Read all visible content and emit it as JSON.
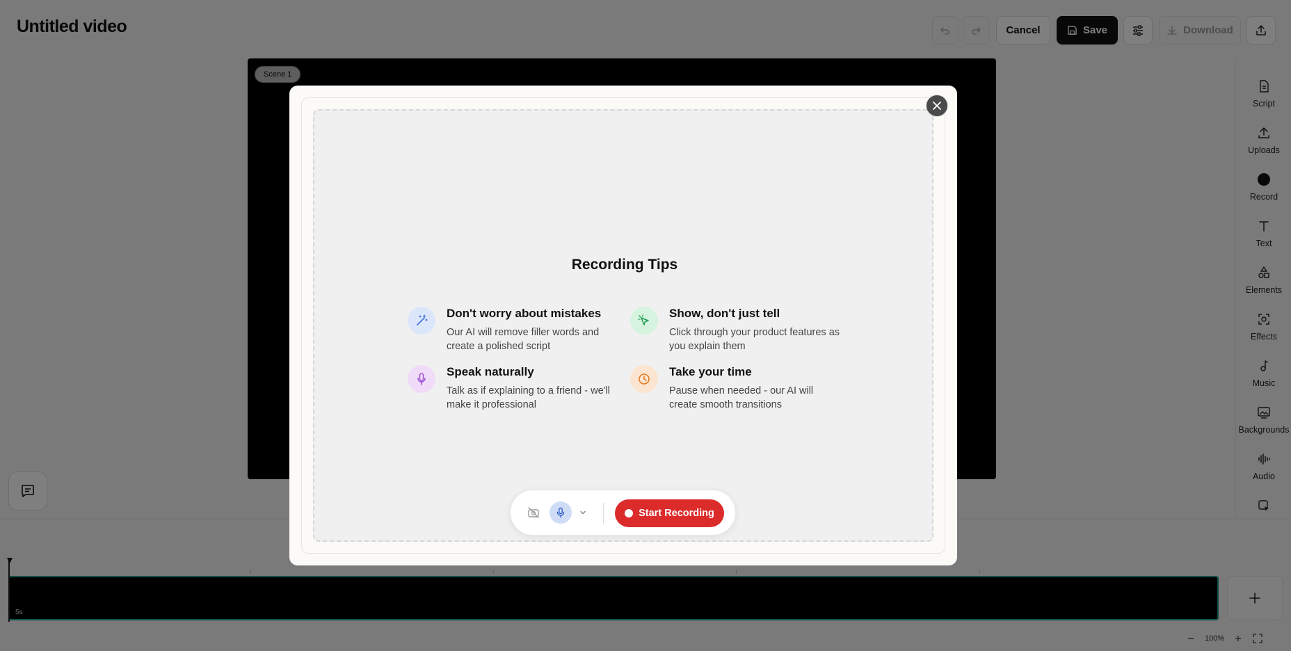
{
  "header": {
    "title": "Untitled video",
    "cancel_label": "Cancel",
    "save_label": "Save",
    "download_label": "Download"
  },
  "canvas": {
    "scene_label": "Scene 1"
  },
  "sidebar": {
    "items": [
      {
        "label": "Script",
        "icon": "document-icon"
      },
      {
        "label": "Uploads",
        "icon": "upload-icon"
      },
      {
        "label": "Record",
        "icon": "record-icon"
      },
      {
        "label": "Text",
        "icon": "text-icon"
      },
      {
        "label": "Elements",
        "icon": "shapes-icon"
      },
      {
        "label": "Effects",
        "icon": "effects-icon"
      },
      {
        "label": "Music",
        "icon": "music-note-icon"
      },
      {
        "label": "Backgrounds",
        "icon": "image-icon"
      },
      {
        "label": "Audio",
        "icon": "waveform-icon"
      }
    ]
  },
  "timeline": {
    "clip_duration": "5s",
    "zoom_level": "100%"
  },
  "modal": {
    "title": "Recording Tips",
    "tips": [
      {
        "heading": "Don't worry about mistakes",
        "description": "Our AI will remove filler words and create a polished script",
        "icon": "magic-wand-icon",
        "color": "#3b6fd8"
      },
      {
        "heading": "Show, don't just tell",
        "description": "Click through your product features as you explain them",
        "icon": "cursor-click-icon",
        "color": "#1f9d55"
      },
      {
        "heading": "Speak naturally",
        "description": "Talk as if explaining to a friend - we'll make it professional",
        "icon": "microphone-icon",
        "color": "#9b4fd1"
      },
      {
        "heading": "Take your time",
        "description": "Pause when needed - our AI will create smooth transitions",
        "icon": "clock-icon",
        "color": "#e07a1f"
      }
    ],
    "start_recording_label": "Start Recording"
  },
  "colors": {
    "accent_record": "#dc2b2b",
    "timeline_border": "#1aa38c"
  }
}
